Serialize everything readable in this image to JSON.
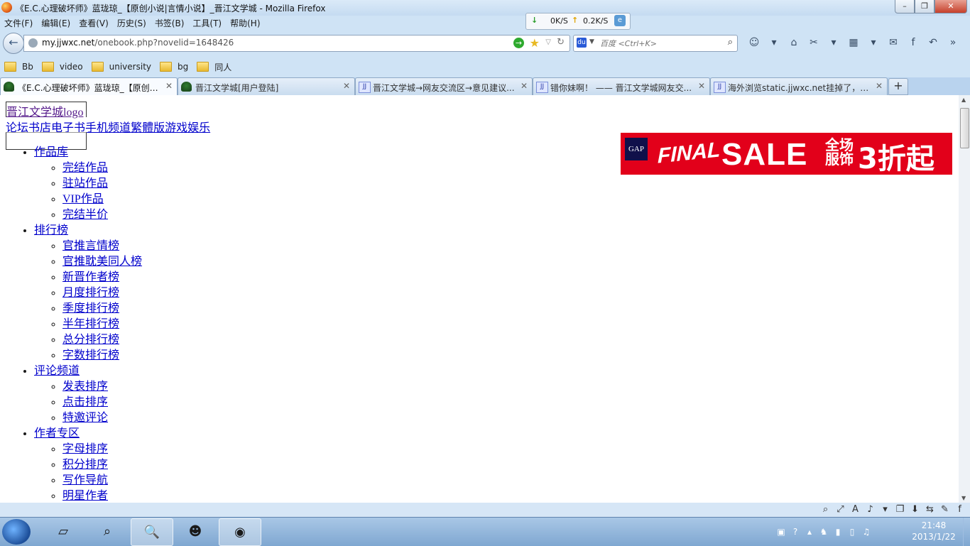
{
  "window": {
    "title": "《E.C.心理破坏师》蓝珑琼_【原创小说|言情小说】_晋江文学城 - Mozilla Firefox",
    "minimize": "–",
    "maximize": "❐",
    "close": "✕"
  },
  "speed": {
    "down": "0K/S",
    "up": "0.2K/S"
  },
  "menu": [
    "文件(F)",
    "编辑(E)",
    "查看(V)",
    "历史(S)",
    "书签(B)",
    "工具(T)",
    "帮助(H)"
  ],
  "nav": {
    "url_host": "my.jjwxc.net",
    "url_path": "/onebook.php?novelid=1648426",
    "search_placeholder": "百度 <Ctrl+K>"
  },
  "bookmarks": [
    "Bb",
    "video",
    "university",
    "bg",
    "同人"
  ],
  "tabs": [
    {
      "label": "《E.C.心理破坏师》蓝珑琼_【原创小...",
      "icon": "tree",
      "active": true
    },
    {
      "label": "晋江文学城[用户登陆]",
      "icon": "tree",
      "active": false
    },
    {
      "label": "晋江文学城→网友交流区→意见建议...",
      "icon": "jj",
      "active": false
    },
    {
      "label": "错你妹啊！ —— 晋江文学城网友交...",
      "icon": "jj",
      "active": false
    },
    {
      "label": "海外浏览static.jjwxc.net挂掉了，晋...",
      "icon": "jj",
      "active": false
    }
  ],
  "page": {
    "logo_link": "晋江文学城logo",
    "topnav": [
      "论坛",
      "书店",
      "电子书",
      "手机频道",
      "繁體版",
      "游戏",
      "娱乐"
    ],
    "sections": [
      {
        "label": "作品库",
        "items": [
          "完结作品",
          "驻站作品",
          "VIP作品",
          "完结半价"
        ]
      },
      {
        "label": "排行榜",
        "items": [
          "官推言情榜",
          "官推耽美同人榜",
          "新晋作者榜",
          "月度排行榜",
          "季度排行榜",
          "半年排行榜",
          "总分排行榜",
          "字数排行榜"
        ]
      },
      {
        "label": "评论频道",
        "items": [
          "发表排序",
          "点击排序",
          "特邀评论"
        ]
      },
      {
        "label": "作者专区",
        "items": [
          "字母排序",
          "积分排序",
          "写作导航",
          "明星作者"
        ]
      }
    ],
    "ad": {
      "brand": "GAP",
      "final": "FINAL",
      "sale": "SALE",
      "cn_small_1": "全场",
      "cn_small_2": "服饰",
      "cn_big": "3折起"
    }
  },
  "taskbar": {
    "time": "21:48",
    "date": "2013/1/22"
  }
}
